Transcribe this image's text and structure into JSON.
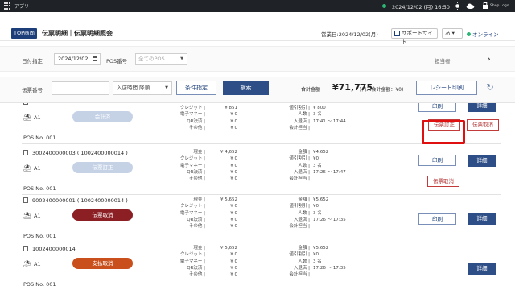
{
  "os_bar": {
    "app_name": "アプリ",
    "datetime": "2024/12/02 (月) 16:50",
    "shop_logo": "Shop Logo"
  },
  "nav": {
    "top_label": "TOP画面",
    "title": "伝票明細｜伝票明細照会",
    "business_date": "営業日:2024/12/02(月)",
    "support": "サポートサイト",
    "lang": "あ",
    "online": "オンライン"
  },
  "filter": {
    "date_label": "日付指定",
    "date_value": "2024/12/02",
    "pos_label": "POS番号",
    "pos_value": "全てのPOS",
    "staff_label": "担当者",
    "chevron": "›"
  },
  "search": {
    "slip_label": "伝票番号",
    "slip_value": "",
    "sort_value": "入店時間 降順",
    "condition_button": "条件指定",
    "search_button": "検索",
    "total_label": "合計金額",
    "total_amount": "¥71,775",
    "total_note": "(内未会計金額：¥0)",
    "print_button": "レシート印刷",
    "refresh": "↻"
  },
  "common": {
    "labels1": [
      "クレジット |",
      "電子マネー |",
      "QR決済 |",
      "その他 |"
    ],
    "labels2": [
      "値引割引 |",
      "人数 |",
      "入退店 |",
      "会計担当 |"
    ],
    "print": "印刷",
    "detail": "詳細",
    "correct": "伝票訂正",
    "cancel": "伝票取消"
  },
  "rows": [
    {
      "slip_no": "",
      "table": "A1",
      "status": "会計済",
      "status_color": "#c5d2e6",
      "pos": "POS No. 001",
      "labels1": [
        "クレジット |",
        "電子マネー |",
        "QR決済 |",
        "その他 |"
      ],
      "values1": [
        "¥ 851",
        "¥ 0",
        "¥ 0",
        "¥ 0"
      ],
      "labels2": [
        "値引割引 |",
        "人数 |",
        "入退店 |",
        "会計担当 |"
      ],
      "values2": [
        "¥ 800",
        "3 名",
        "17:41 ～ 17:44",
        ""
      ]
    },
    {
      "slip_no": "3002400000003 ( 1002400000014 )",
      "table": "A1",
      "status": "伝票訂正",
      "status_color": "#c5d2e6",
      "pos": "POS No. 001",
      "labels1": [
        "現金 |",
        "クレジット |",
        "電子マネー |",
        "QR決済 |",
        "その他 |"
      ],
      "values1": [
        "¥ 4,652",
        "¥ 0",
        "¥ 0",
        "¥ 0",
        "¥ 0"
      ],
      "labels2": [
        "金額 |",
        "値引割引 |",
        "人数 |",
        "入退店 |",
        "会計担当 |"
      ],
      "values2": [
        "¥4,652",
        "¥0",
        "3 名",
        "17:26 ～ 17:47",
        ""
      ]
    },
    {
      "slip_no": "9002400000001 ( 1002400000014 )",
      "table": "A1",
      "status": "伝票取消",
      "status_color": "#8b1f24",
      "pos": "POS No. 001",
      "labels1": [
        "現金 |",
        "クレジット |",
        "電子マネー |",
        "QR決済 |",
        "その他 |"
      ],
      "values1": [
        "¥ 5,652",
        "¥ 0",
        "¥ 0",
        "¥ 0",
        "¥ 0"
      ],
      "labels2": [
        "金額 |",
        "値引割引 |",
        "人数 |",
        "入退店 |",
        "会計担当 |"
      ],
      "values2": [
        "¥5,652",
        "¥0",
        "3 名",
        "17:26 ～ 17:35",
        ""
      ]
    },
    {
      "slip_no": "1002400000014",
      "table": "A1",
      "status": "支払取消",
      "status_color": "#c9501c",
      "pos": "POS No. 001",
      "labels1": [
        "現金 |",
        "クレジット |",
        "電子マネー |",
        "QR決済 |",
        "その他 |"
      ],
      "values1": [
        "¥ 5,652",
        "¥ 0",
        "¥ 0",
        "¥ 0",
        "¥ 0"
      ],
      "labels2": [
        "金額 |",
        "値引割引 |",
        "人数 |",
        "入退店 |",
        "会計担当 |"
      ],
      "values2": [
        "¥5,652",
        "¥0",
        "3 名",
        "17:26 ～ 17:35",
        ""
      ]
    }
  ]
}
